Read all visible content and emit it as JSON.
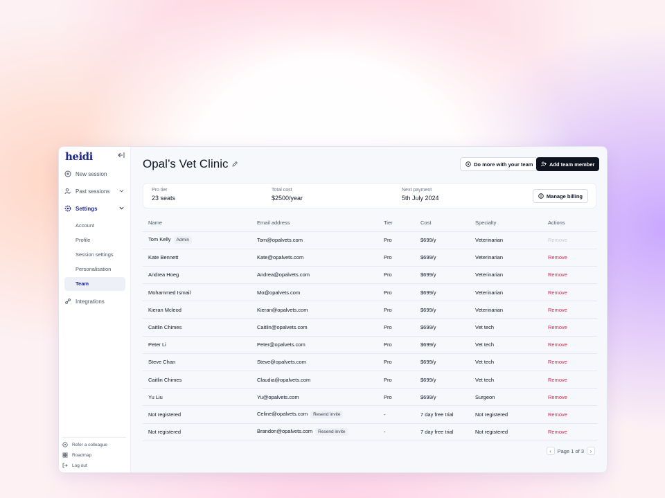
{
  "app": {
    "logo": "heidi"
  },
  "sidebar": {
    "new_session": "New session",
    "past_sessions": "Past sessions",
    "settings": "Settings",
    "sub_items": [
      "Account",
      "Profile",
      "Session settings",
      "Personalisation",
      "Team"
    ],
    "integrations": "Integrations",
    "footer": [
      "Refer a colleague",
      "Roadmap",
      "Log out"
    ]
  },
  "header": {
    "title": "Opal’s Vet Clinic",
    "do_more_label": "Do more with your team",
    "add_member_label": "Add team member"
  },
  "summary": {
    "tier_label": "Pro tier",
    "tier_value": "23 seats",
    "cost_label": "Total cost",
    "cost_value": "$2500/year",
    "next_label": "Next payment",
    "next_value": "5th July 2024",
    "billing_label": "Manage billing"
  },
  "table": {
    "headers": [
      "Name",
      "Email address",
      "Tier",
      "Cost",
      "Specialty",
      "Actions"
    ],
    "rows": [
      {
        "name": "Tom Kelly",
        "badge": "Admin",
        "email": "Tom@opalvets.com",
        "tier": "Pro",
        "cost": "$699/y",
        "specialty": "Veterinarian",
        "action": "Remove"
      },
      {
        "name": "Kate Bennett",
        "email": "Kate@opalvets.com",
        "tier": "Pro",
        "cost": "$699/y",
        "specialty": "Veterinarian",
        "action": "Remove"
      },
      {
        "name": "Andrea Hoeg",
        "email": "Andrea@opalvets.com",
        "tier": "Pro",
        "cost": "$699/y",
        "specialty": "Veterinarian",
        "action": "Remove"
      },
      {
        "name": "Mohammed Ismail",
        "email": "Mo@opalvets.com",
        "tier": "Pro",
        "cost": "$699/y",
        "specialty": "Veterinarian",
        "action": "Remove"
      },
      {
        "name": "Kieran Mcleod",
        "email": "Kieran@opalvets.com",
        "tier": "Pro",
        "cost": "$699/y",
        "specialty": "Veterinarian",
        "action": "Remove"
      },
      {
        "name": "Caitlin Chimes",
        "email": "Caitlin@opalvets.com",
        "tier": "Pro",
        "cost": "$699/y",
        "specialty": "Vet tech",
        "action": "Remove"
      },
      {
        "name": "Peter Li",
        "email": "Peter@opalvets.com",
        "tier": "Pro",
        "cost": "$699/y",
        "specialty": "Vet tech",
        "action": "Remove"
      },
      {
        "name": "Steve Chan",
        "email": "Steve@opalvets.com",
        "tier": "Pro",
        "cost": "$699/y",
        "specialty": "Vet tech",
        "action": "Remove"
      },
      {
        "name": "Caitlin Chimes",
        "email": "Claudia@opalvets.com",
        "tier": "Pro",
        "cost": "$699/y",
        "specialty": "Vet tech",
        "action": "Remove"
      },
      {
        "name": "Yu Liu",
        "email": "Yu@opalvets.com",
        "tier": "Pro",
        "cost": "$699/y",
        "specialty": "Surgeon",
        "action": "Remove"
      },
      {
        "name": "Not registered",
        "email": "Celine@opalvets.com",
        "badge": "Resend invite",
        "tier": "-",
        "cost": "7 day free trial",
        "specialty": "Not registered",
        "action": "Remove"
      },
      {
        "name": "Not registered",
        "email": "Brandon@opalvets.com",
        "badge": "Resend invite",
        "tier": "-",
        "cost": "7 day free trial",
        "specialty": "Not registered",
        "action": "Remove"
      }
    ]
  },
  "pagination": {
    "label": "Page 1 of 3",
    "prev": "‹",
    "next": "›"
  },
  "colors": {
    "brand": "#1e2a8c",
    "danger": "#e11d48",
    "primary_button": "#0f1320"
  }
}
